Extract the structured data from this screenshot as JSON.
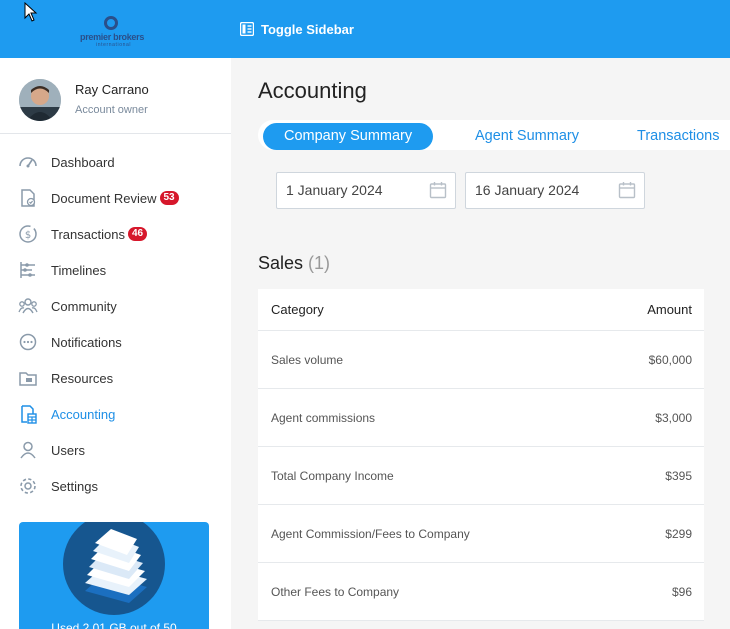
{
  "topbar": {
    "logo_text": "premier brokers",
    "logo_subtext": "international",
    "toggle_label": "Toggle Sidebar"
  },
  "profile": {
    "name": "Ray Carrano",
    "role": "Account owner"
  },
  "nav": {
    "items": [
      {
        "label": "Dashboard",
        "icon": "dashboard-icon"
      },
      {
        "label": "Document Review",
        "icon": "document-review-icon",
        "badge": "53"
      },
      {
        "label": "Transactions",
        "icon": "transactions-icon",
        "badge": "46"
      },
      {
        "label": "Timelines",
        "icon": "timelines-icon"
      },
      {
        "label": "Community",
        "icon": "community-icon"
      },
      {
        "label": "Notifications",
        "icon": "notifications-icon"
      },
      {
        "label": "Resources",
        "icon": "resources-icon"
      },
      {
        "label": "Accounting",
        "icon": "accounting-icon",
        "active": true
      },
      {
        "label": "Users",
        "icon": "users-icon"
      },
      {
        "label": "Settings",
        "icon": "settings-icon"
      }
    ]
  },
  "storage": {
    "text": "Used 2.01 GB out of 50"
  },
  "main": {
    "title": "Accounting",
    "tabs": [
      {
        "label": "Company Summary",
        "active": true
      },
      {
        "label": "Agent Summary"
      },
      {
        "label": "Transactions"
      }
    ],
    "date_from": "1 January 2024",
    "date_to": "16 January 2024"
  },
  "sales": {
    "title": "Sales",
    "count": "(1)",
    "headers": {
      "category": "Category",
      "amount": "Amount"
    },
    "rows": [
      {
        "category": "Sales volume",
        "amount": "$60,000"
      },
      {
        "category": "Agent commissions",
        "amount": "$3,000"
      },
      {
        "category": "Total Company Income",
        "amount": "$395"
      },
      {
        "category": "Agent Commission/Fees to Company",
        "amount": "$299"
      },
      {
        "category": "Other Fees to Company",
        "amount": "$96"
      }
    ]
  },
  "colors": {
    "brand": "#1e9bf0",
    "active_text": "#1e8fe6",
    "badge": "#d6172b"
  }
}
